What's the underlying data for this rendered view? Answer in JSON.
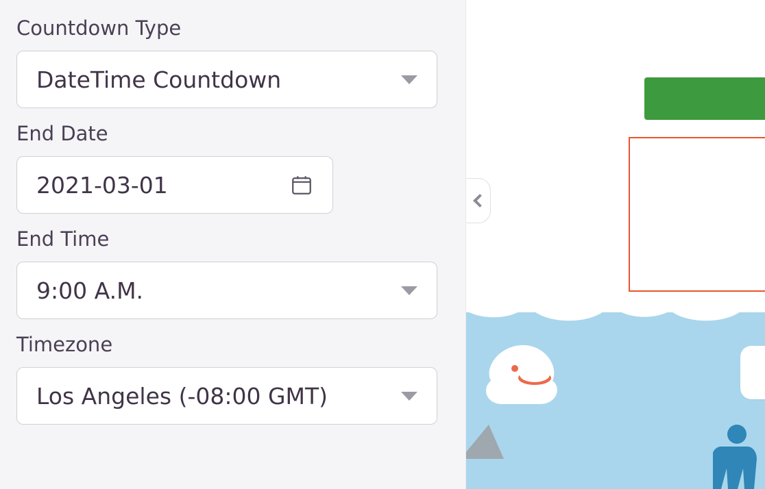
{
  "sidebar": {
    "countdown_type": {
      "label": "Countdown Type",
      "value": "DateTime Countdown"
    },
    "end_date": {
      "label": "End Date",
      "value": "2021-03-01"
    },
    "end_time": {
      "label": "End Time",
      "value": "9:00 A.M."
    },
    "timezone": {
      "label": "Timezone",
      "value": "Los Angeles (-08:00 GMT)"
    }
  },
  "colors": {
    "green_button": "#3e9a3e",
    "highlight_border": "#e8552b",
    "sea": "#a9d6ec"
  }
}
